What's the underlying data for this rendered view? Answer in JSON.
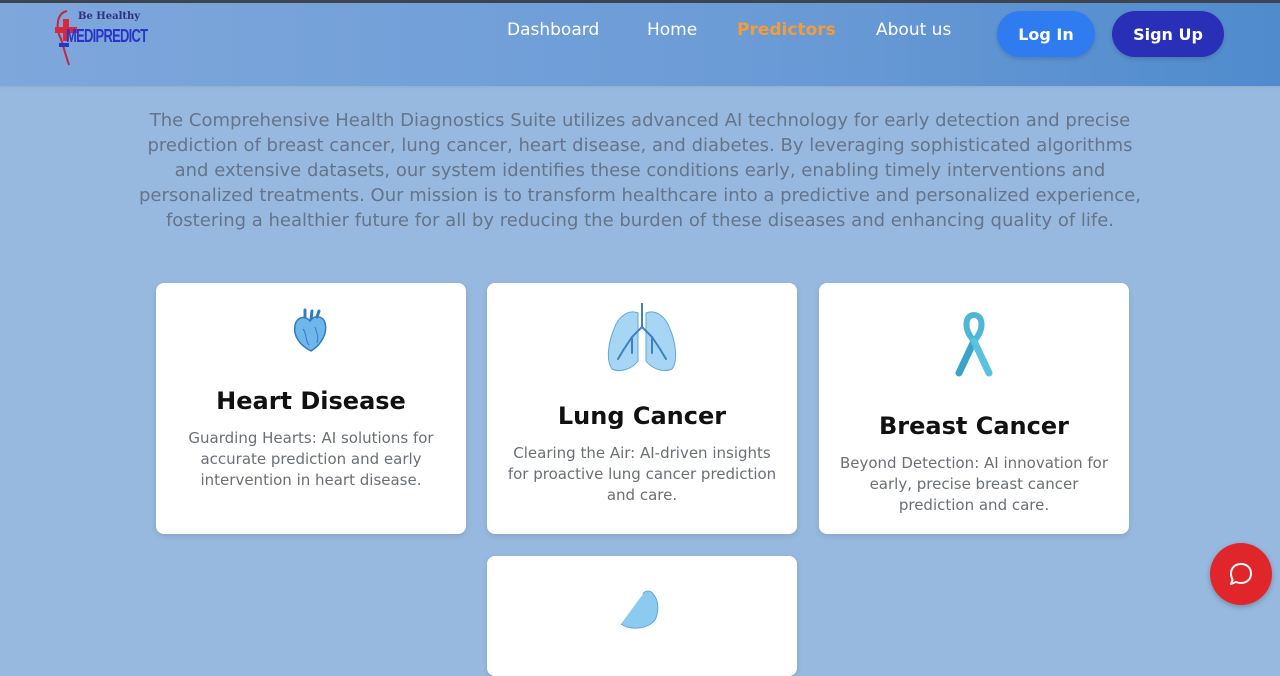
{
  "brand": {
    "tagline": "Be Healthy",
    "name": "MEDIPREDICT"
  },
  "nav": {
    "links": [
      {
        "label": "Dashboard"
      },
      {
        "label": "Home"
      },
      {
        "label": "Predictors"
      },
      {
        "label": "About us"
      }
    ],
    "active": "Predictors",
    "login_label": "Log In",
    "signup_label": "Sign Up"
  },
  "intro": {
    "text": "The Comprehensive Health Diagnostics Suite utilizes advanced AI technology for early detection and precise prediction of breast cancer, lung cancer, heart disease, and diabetes. By leveraging sophisticated algorithms and extensive datasets, our system identifies these conditions early, enabling timely interventions and personalized treatments. Our mission is to transform healthcare into a predictive and personalized experience, fostering a healthier future for all by reducing the burden of these diseases and enhancing quality of life."
  },
  "cards": [
    {
      "title": "Heart Disease",
      "description": "Guarding Hearts: AI solutions for accurate prediction and early intervention in heart disease.",
      "icon": "heart-organ-icon"
    },
    {
      "title": "Lung Cancer",
      "description": "Clearing the Air: AI-driven insights for proactive lung cancer prediction and care.",
      "icon": "lungs-icon"
    },
    {
      "title": "Breast Cancer",
      "description": "Beyond Detection: AI innovation for early, precise breast cancer prediction and care.",
      "icon": "awareness-ribbon-icon"
    },
    {
      "title": "",
      "description": "",
      "icon": "stomach-icon"
    }
  ],
  "chat": {
    "icon": "chat-bubble-icon"
  },
  "colors": {
    "page_background": "#98b9df",
    "navbar": "#6b9bd6",
    "active_link": "#f29d3a",
    "login_button": "#2f7cf0",
    "signup_button": "#2a2fb8",
    "chat_button": "#e0262a"
  }
}
